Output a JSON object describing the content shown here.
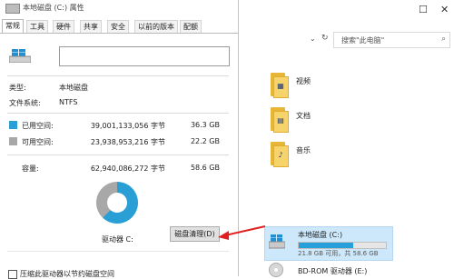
{
  "dialog": {
    "title": "本地磁盘 (C:) 属性",
    "tabs": [
      "常规",
      "工具",
      "硬件",
      "共享",
      "安全",
      "以前的版本",
      "配额"
    ],
    "name_value": "",
    "type_label": "类型:",
    "type_value": "本地磁盘",
    "fs_label": "文件系统:",
    "fs_value": "NTFS",
    "used": {
      "label": "已用空间:",
      "bytes": "39,001,133,056 字节",
      "size": "36.3 GB",
      "color": "#2a9fd6"
    },
    "free": {
      "label": "可用空间:",
      "bytes": "23,938,953,216 字节",
      "size": "22.2 GB",
      "color": "#a8a8a8"
    },
    "capacity": {
      "label": "容量:",
      "bytes": "62,940,086,272 字节",
      "size": "58.6 GB"
    },
    "used_fraction": 0.62,
    "drive_label": "驱动器 C:",
    "clean_button": "磁盘清理(D)",
    "bottom_text": "压缩此驱动器以节约磁盘空间"
  },
  "explorer": {
    "search_placeholder": "搜索\"此电脑\"",
    "folders": [
      "视频",
      "文档",
      "音乐"
    ],
    "drive_c": {
      "name": "本地磁盘 (C:)",
      "space": "21.8 GB 可用，共 58.6 GB",
      "used_fraction": 0.63
    },
    "drive_e": {
      "name": "BD-ROM 驱动器 (E:)"
    }
  },
  "colors": {
    "accent": "#26a0da",
    "arrow": "#e02020"
  }
}
